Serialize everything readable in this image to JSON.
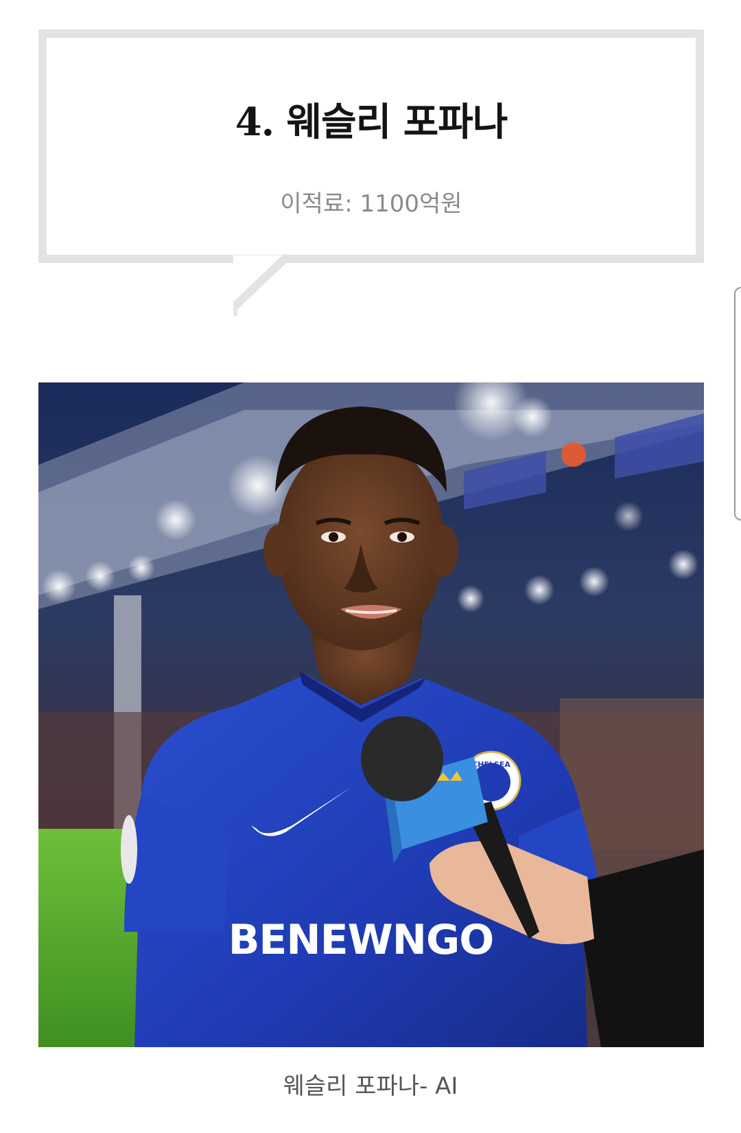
{
  "header": {
    "title": "4. 웨슬리 포파나",
    "subtitle": "이적료: 1100억원"
  },
  "photo": {
    "shirt_sponsor": "BENEWNGO",
    "crest_text": "CHELSEA"
  },
  "caption": "웨슬리 포파나- AI",
  "colors": {
    "bubble_border": "#e3e3e3",
    "title": "#141414",
    "subtitle": "#8a8a8a",
    "caption": "#555555",
    "jersey": "#1f3bb3"
  }
}
